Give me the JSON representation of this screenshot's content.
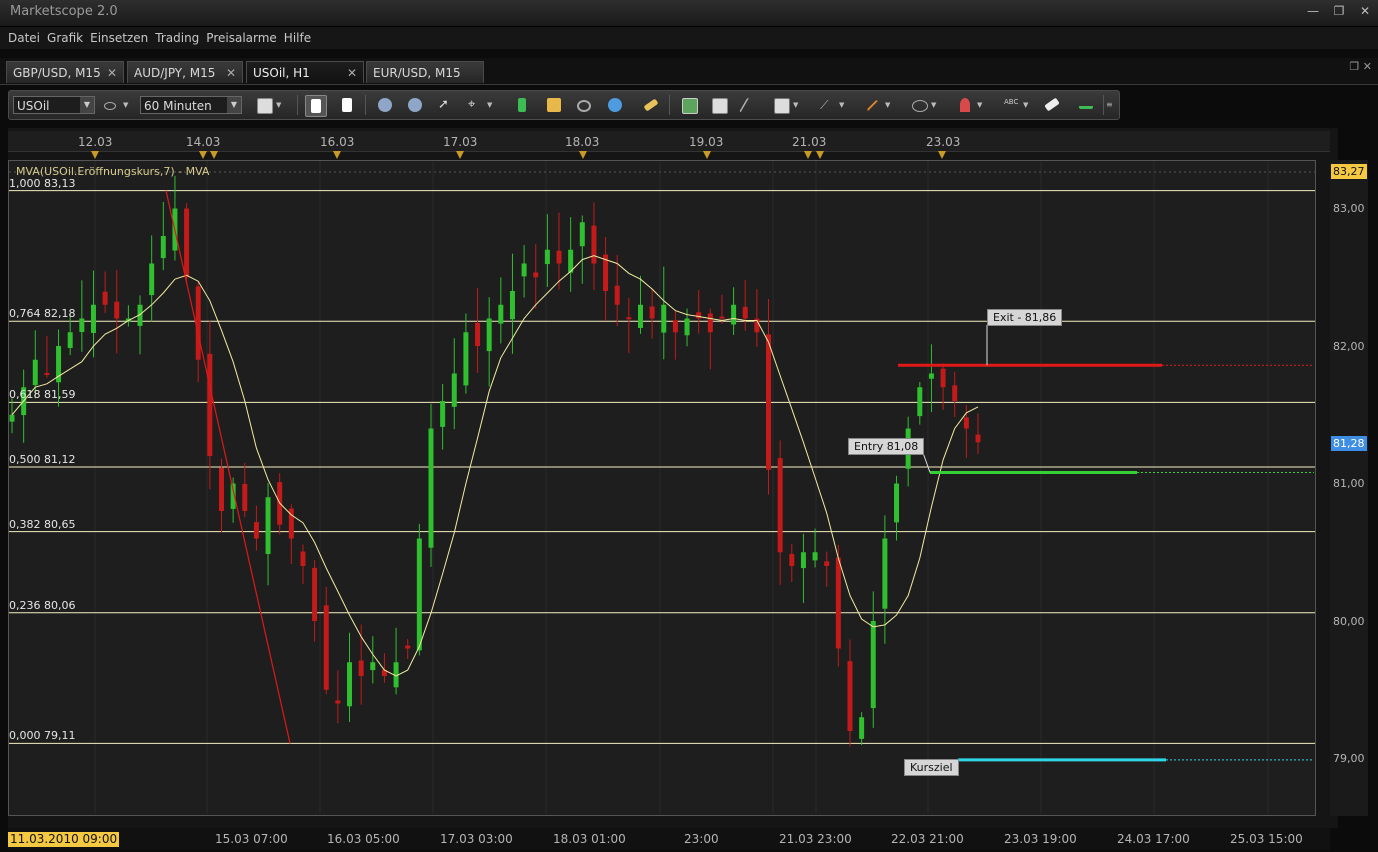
{
  "app": {
    "title": "Marketscope 2.0"
  },
  "window_buttons": [
    {
      "name": "minimize-button",
      "glyph": "—"
    },
    {
      "name": "maximize-button",
      "glyph": "❐"
    },
    {
      "name": "close-button",
      "glyph": "✕"
    }
  ],
  "menu": [
    "Datei",
    "Grafik",
    "Einsetzen",
    "Trading",
    "Preisalarme",
    "Hilfe"
  ],
  "tabs": [
    {
      "label": "GBP/USD, M15",
      "active": false
    },
    {
      "label": "AUD/JPY, M15",
      "active": false
    },
    {
      "label": "USOil, H1",
      "active": true
    },
    {
      "label": "EUR/USD, M15",
      "active": false
    }
  ],
  "toolbar": {
    "instrument": "USOil",
    "timeframe": "60 Minuten"
  },
  "top_dates": [
    "12.03",
    "14.03",
    "16.03",
    "17.03",
    "18.03",
    "19.03",
    "21.03",
    "23.03"
  ],
  "bottom_dates": [
    "15.03 07:00",
    "16.03 05:00",
    "17.03 03:00",
    "18.03 01:00",
    "23:00",
    "21.03 23:00",
    "22.03 21:00",
    "23.03 19:00",
    "24.03 17:00",
    "25.03 15:00"
  ],
  "cursor_date": "11.03.2010 09:00",
  "price_axis": [
    "83,00",
    "82,00",
    "81,00",
    "80,00",
    "79,00"
  ],
  "price_marker_top": "83,27",
  "price_marker_current": "81,28",
  "indicator_label": "MVA(USOil.Eröffnungskurs,7) - MVA",
  "fib_levels": [
    {
      "label": "1,000 83,13",
      "price": 83.13
    },
    {
      "label": "0,764 82,18",
      "price": 82.18
    },
    {
      "label": "0,618 81,59",
      "price": 81.59
    },
    {
      "label": "0,500 81,12",
      "price": 81.12
    },
    {
      "label": "0,382 80,65",
      "price": 80.65
    },
    {
      "label": "0,236 80,06",
      "price": 80.06
    },
    {
      "label": "0,000 79,11",
      "price": 79.11
    }
  ],
  "orders": {
    "exit": {
      "label": "Exit - 81,86",
      "price": 81.86,
      "color": "#e01818"
    },
    "entry": {
      "label": "Entry 81,08",
      "price": 81.08,
      "color": "#35d035"
    },
    "target": {
      "label": "Kursziel",
      "price": 78.99,
      "color": "#2fd6e6"
    }
  },
  "colors": {
    "bull": "#2fbf2f",
    "bear": "#c41a1a",
    "ma": "#f2eca0",
    "fib": "#f5efc2",
    "trend": "#e01818",
    "price_marker_top": "#f5c842",
    "price_marker_current": "#3f8ee6",
    "cursor_date_bg": "#f5c842"
  },
  "chart_data": {
    "type": "candlestick",
    "ylim": [
      78.5,
      83.35
    ],
    "close_path": [
      81.5,
      81.7,
      81.9,
      81.8,
      82.0,
      82.1,
      82.2,
      82.3,
      82.3,
      82.2,
      82.2,
      82.3,
      82.6,
      82.8,
      83.0,
      82.5,
      81.9,
      81.2,
      80.8,
      81.0,
      80.8,
      80.6,
      80.9,
      80.7,
      80.6,
      80.4,
      80.0,
      79.5,
      79.4,
      79.7,
      79.6,
      79.7,
      79.6,
      79.7,
      79.8,
      80.6,
      81.4,
      81.6,
      81.8,
      82.1,
      82.0,
      82.2,
      82.3,
      82.4,
      82.6,
      82.5,
      82.7,
      82.6,
      82.7,
      82.9,
      82.6,
      82.4,
      82.3,
      82.2,
      82.3,
      82.2,
      82.3,
      82.1,
      82.2,
      82.2,
      82.1,
      82.2,
      82.3,
      82.2,
      82.1,
      81.1,
      80.5,
      80.4,
      80.5,
      80.5,
      80.4,
      79.8,
      79.2,
      79.3,
      80.0,
      80.6,
      81.0,
      81.4,
      81.7,
      81.8,
      81.7,
      81.6,
      81.4,
      81.3
    ],
    "moving_average": "MVA 7"
  }
}
